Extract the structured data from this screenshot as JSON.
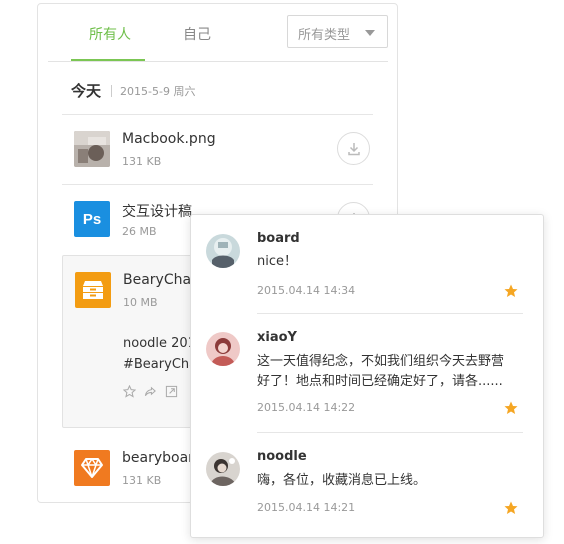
{
  "files_panel": {
    "tabs": [
      {
        "label": "所有人",
        "active": true
      },
      {
        "label": "自己",
        "active": false
      }
    ],
    "type_filter": {
      "selected": "所有类型"
    },
    "day": {
      "title": "今天",
      "date": "2015-5-9 周六"
    },
    "files": [
      {
        "name": "Macbook.png",
        "size": "131 KB",
        "icon": "image-thumbnail"
      },
      {
        "name": "交互设计稿",
        "size": "26 MB",
        "icon": "photoshop-file-icon",
        "icon_text": "Ps",
        "icon_color": "#1a8fe0"
      },
      {
        "name": "BearyChat_",
        "size": "10 MB",
        "icon": "archive-file-icon",
        "icon_color": "#f39c12",
        "message_lines": [
          "noodle 201",
          "#BearyCha"
        ]
      },
      {
        "name": "bearyboard",
        "size": "131 KB",
        "icon": "sketch-file-icon",
        "icon_color": "#f07a20"
      }
    ]
  },
  "favorites": {
    "items": [
      {
        "user": "board",
        "lines": [
          "nice！"
        ],
        "time": "2015.04.14 14:34"
      },
      {
        "user": "xiaoY",
        "lines": [
          "这一天值得纪念，不如我们组织今天去野营",
          "好了！地点和时间已经确定好了，请各......"
        ],
        "time": "2015.04.14 14:22"
      },
      {
        "user": "noodle",
        "lines": [
          "嗨，各位，收藏消息已上线。"
        ],
        "time": "2015.04.14 14:21"
      }
    ],
    "star_color": "#f5a623"
  },
  "colors": {
    "accent": "#7bc653",
    "ps_blue": "#1a8fe0",
    "archive_orange": "#f39c12",
    "sketch_orange": "#f07a20"
  }
}
